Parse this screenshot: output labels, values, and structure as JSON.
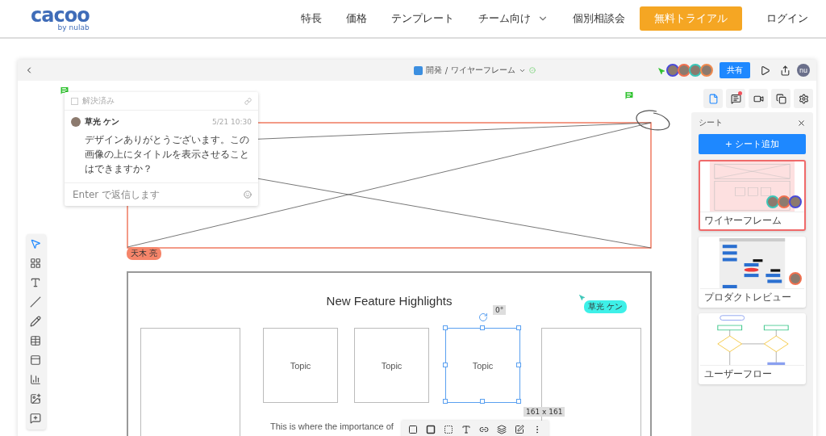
{
  "nav": {
    "logo": "cacoo",
    "logo_sub": "by nulab",
    "items": [
      {
        "label": "特長",
        "kind": "link"
      },
      {
        "label": "価格",
        "kind": "link"
      },
      {
        "label": "テンプレート",
        "kind": "link"
      },
      {
        "label": "チーム向け",
        "kind": "dropdown"
      },
      {
        "label": "個別相談会",
        "kind": "link"
      },
      {
        "label": "無料トライアル",
        "kind": "cta"
      },
      {
        "label": "ログイン",
        "kind": "link"
      }
    ]
  },
  "app_header": {
    "folder": "開発",
    "separator": "/",
    "document": "ワイヤーフレーム",
    "saved": true,
    "collaborators": [
      {
        "color": "#4a4ad8"
      },
      {
        "color": "#f0704f"
      },
      {
        "color": "#3cc6b8"
      },
      {
        "color": "#f08a4f"
      }
    ],
    "share_button": "共有",
    "user_initials": "nu"
  },
  "side_tools": [
    {
      "kind": "sheets",
      "selected": true,
      "unread": false
    },
    {
      "kind": "comments",
      "selected": false,
      "unread": true
    },
    {
      "kind": "video",
      "selected": false,
      "unread": false
    },
    {
      "kind": "pages",
      "selected": false,
      "unread": false
    },
    {
      "kind": "settings",
      "selected": false,
      "unread": false
    }
  ],
  "sheets_panel": {
    "title": "シート",
    "add_button": "+ シート追加",
    "sheets": [
      {
        "name": "ワイヤーフレーム",
        "kind": "wireframe",
        "selected": true,
        "viewers": [
          {
            "color": "#3cc6b8"
          },
          {
            "color": "#f0704f"
          },
          {
            "color": "#4a4ad8"
          }
        ]
      },
      {
        "name": "プロダクトレビュー",
        "kind": "flowchart",
        "selected": false,
        "viewers": [
          {
            "color": "#f0704f"
          }
        ]
      },
      {
        "name": "ユーザーフロー",
        "kind": "userflow",
        "selected": false
      }
    ]
  },
  "comment": {
    "resolved_label": "解決済み",
    "resolved": false,
    "author": "草光 ケン",
    "time": "5/21 10:30",
    "text": "デザインありがとうございます。この画像の上にタイトルを表示させることはできますか？",
    "reply_placeholder": "Enter で返信します"
  },
  "canvas": {
    "selection_owner": "天木 亮",
    "cursor_user": "草光 ケン",
    "rotation": "0°",
    "size": "161 x 161",
    "wireframe": {
      "title": "New Feature Highlights",
      "topics": [
        {
          "label": "Topic",
          "selected": false
        },
        {
          "label": "Topic",
          "selected": false
        },
        {
          "label": "Topic",
          "selected": true
        }
      ],
      "body": "This is where the importance of"
    }
  },
  "tools": [
    {
      "kind": "select",
      "selected": true
    },
    {
      "kind": "shapes",
      "selected": false
    },
    {
      "kind": "text",
      "selected": false
    },
    {
      "kind": "line",
      "selected": false
    },
    {
      "kind": "pen",
      "selected": false
    },
    {
      "kind": "table",
      "selected": false
    },
    {
      "kind": "frame",
      "selected": false
    },
    {
      "kind": "chart",
      "selected": false
    },
    {
      "kind": "image",
      "selected": false
    },
    {
      "kind": "comment",
      "selected": false
    }
  ]
}
